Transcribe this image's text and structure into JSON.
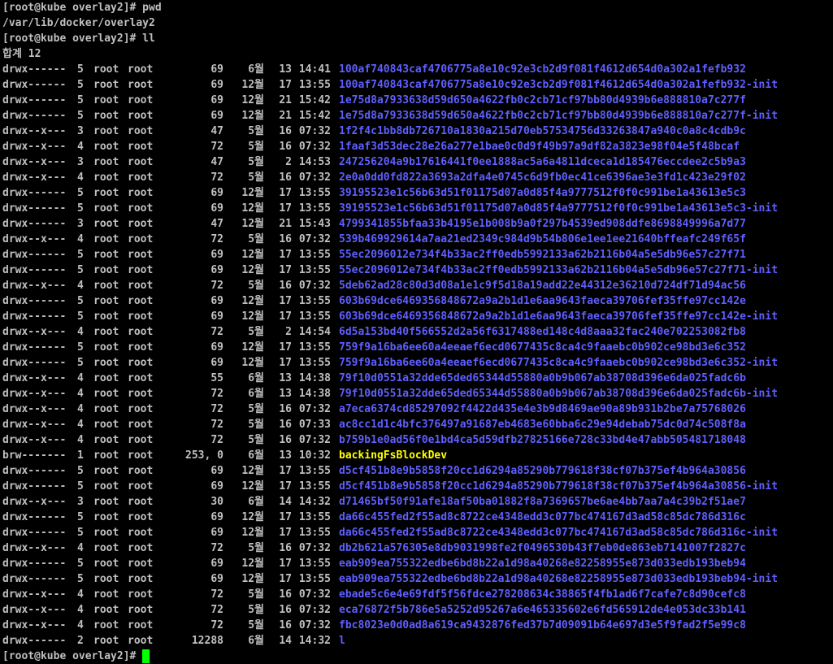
{
  "colors": {
    "background": "#000000",
    "text": "#c0c0c0",
    "directory": "#5f5fff",
    "block_device": "#ffff00",
    "cursor": "#00ff00"
  },
  "terminal": {
    "lines": [
      "[root@kube overlay2]# pwd",
      "/var/lib/docker/overlay2",
      "[root@kube overlay2]# ll",
      "합계 12"
    ],
    "entries": [
      {
        "perms": "drwx------",
        "links": "5",
        "owner": "root",
        "group": "root",
        "size": "69",
        "month": "6월",
        "day": "13",
        "time": "14:41",
        "name": "100af740843caf4706775a8e10c92e3cb2d9f081f4612d654d0a302a1fefb932",
        "kind": "dir"
      },
      {
        "perms": "drwx------",
        "links": "5",
        "owner": "root",
        "group": "root",
        "size": "69",
        "month": "12월",
        "day": "17",
        "time": "13:55",
        "name": "100af740843caf4706775a8e10c92e3cb2d9f081f4612d654d0a302a1fefb932-init",
        "kind": "dir"
      },
      {
        "perms": "drwx------",
        "links": "5",
        "owner": "root",
        "group": "root",
        "size": "69",
        "month": "12월",
        "day": "21",
        "time": "15:42",
        "name": "1e75d8a7933638d59d650a4622fb0c2cb71cf97bb80d4939b6e888810a7c277f",
        "kind": "dir"
      },
      {
        "perms": "drwx------",
        "links": "5",
        "owner": "root",
        "group": "root",
        "size": "69",
        "month": "12월",
        "day": "21",
        "time": "15:42",
        "name": "1e75d8a7933638d59d650a4622fb0c2cb71cf97bb80d4939b6e888810a7c277f-init",
        "kind": "dir"
      },
      {
        "perms": "drwx--x---",
        "links": "3",
        "owner": "root",
        "group": "root",
        "size": "47",
        "month": "5월",
        "day": "16",
        "time": "07:32",
        "name": "1f2f4c1bb8db726710a1830a215d70eb57534756d33263847a940c0a8c4cdb9c",
        "kind": "dir"
      },
      {
        "perms": "drwx--x---",
        "links": "4",
        "owner": "root",
        "group": "root",
        "size": "72",
        "month": "5월",
        "day": "16",
        "time": "07:32",
        "name": "1faaf3d53dec28e26a277e1bae0c0d9f49b97a9df82a3823e98f04e5f48bcaf",
        "kind": "dir"
      },
      {
        "perms": "drwx--x---",
        "links": "3",
        "owner": "root",
        "group": "root",
        "size": "47",
        "month": "5월",
        "day": "2",
        "time": "14:53",
        "name": "247256204a9b17616441f0ee1888ac5a6a4811dceca1d185476eccdee2c5b9a3",
        "kind": "dir"
      },
      {
        "perms": "drwx--x---",
        "links": "4",
        "owner": "root",
        "group": "root",
        "size": "72",
        "month": "5월",
        "day": "16",
        "time": "07:32",
        "name": "2e0a0dd0fd822a3693a2dfa4e0745c6d9fb0ec41ce6396ae3e3fd1c423e29f02",
        "kind": "dir"
      },
      {
        "perms": "drwx------",
        "links": "5",
        "owner": "root",
        "group": "root",
        "size": "69",
        "month": "12월",
        "day": "17",
        "time": "13:55",
        "name": "39195523e1c56b63d51f01175d07a0d85f4a9777512f0f0c991be1a43613e5c3",
        "kind": "dir"
      },
      {
        "perms": "drwx------",
        "links": "5",
        "owner": "root",
        "group": "root",
        "size": "69",
        "month": "12월",
        "day": "17",
        "time": "13:55",
        "name": "39195523e1c56b63d51f01175d07a0d85f4a9777512f0f0c991be1a43613e5c3-init",
        "kind": "dir"
      },
      {
        "perms": "drwx------",
        "links": "3",
        "owner": "root",
        "group": "root",
        "size": "47",
        "month": "12월",
        "day": "21",
        "time": "15:43",
        "name": "4799341855bfaa33b4195e1b008b9a0f297b4539ed908ddfe8698849996a7d77",
        "kind": "dir"
      },
      {
        "perms": "drwx--x---",
        "links": "4",
        "owner": "root",
        "group": "root",
        "size": "72",
        "month": "5월",
        "day": "16",
        "time": "07:32",
        "name": "539b469929614a7aa21ed2349c984d9b54b806e1ee1ee21640bffeafc249f65f",
        "kind": "dir"
      },
      {
        "perms": "drwx------",
        "links": "5",
        "owner": "root",
        "group": "root",
        "size": "69",
        "month": "12월",
        "day": "17",
        "time": "13:55",
        "name": "55ec2096012e734f4b33ac2ff0edb5992133a62b2116b04a5e5db96e57c27f71",
        "kind": "dir"
      },
      {
        "perms": "drwx------",
        "links": "5",
        "owner": "root",
        "group": "root",
        "size": "69",
        "month": "12월",
        "day": "17",
        "time": "13:55",
        "name": "55ec2096012e734f4b33ac2ff0edb5992133a62b2116b04a5e5db96e57c27f71-init",
        "kind": "dir"
      },
      {
        "perms": "drwx--x---",
        "links": "4",
        "owner": "root",
        "group": "root",
        "size": "72",
        "month": "5월",
        "day": "16",
        "time": "07:32",
        "name": "5deb62ad28c80d3d08a1e1c9f5d18a19add22e44312e36210d724df71d94ac56",
        "kind": "dir"
      },
      {
        "perms": "drwx------",
        "links": "5",
        "owner": "root",
        "group": "root",
        "size": "69",
        "month": "12월",
        "day": "17",
        "time": "13:55",
        "name": "603b69dce6469356848672a9a2b1d1e6aa9643faeca39706fef35ffe97cc142e",
        "kind": "dir"
      },
      {
        "perms": "drwx------",
        "links": "5",
        "owner": "root",
        "group": "root",
        "size": "69",
        "month": "12월",
        "day": "17",
        "time": "13:55",
        "name": "603b69dce6469356848672a9a2b1d1e6aa9643faeca39706fef35ffe97cc142e-init",
        "kind": "dir"
      },
      {
        "perms": "drwx--x---",
        "links": "4",
        "owner": "root",
        "group": "root",
        "size": "72",
        "month": "5월",
        "day": "2",
        "time": "14:54",
        "name": "6d5a153bd40f566552d2a56f6317488ed148c4d8aaa32fac240e702253082fb8",
        "kind": "dir"
      },
      {
        "perms": "drwx------",
        "links": "5",
        "owner": "root",
        "group": "root",
        "size": "69",
        "month": "12월",
        "day": "17",
        "time": "13:55",
        "name": "759f9a16ba6ee60a4eeaef6ecd0677435c8ca4c9faaebc0b902ce98bd3e6c352",
        "kind": "dir"
      },
      {
        "perms": "drwx------",
        "links": "5",
        "owner": "root",
        "group": "root",
        "size": "69",
        "month": "12월",
        "day": "17",
        "time": "13:55",
        "name": "759f9a16ba6ee60a4eeaef6ecd0677435c8ca4c9faaebc0b902ce98bd3e6c352-init",
        "kind": "dir"
      },
      {
        "perms": "drwx--x---",
        "links": "4",
        "owner": "root",
        "group": "root",
        "size": "55",
        "month": "6월",
        "day": "13",
        "time": "14:38",
        "name": "79f10d0551a32dde65ded65344d55880a0b9b067ab38708d396e6da025fadc6b",
        "kind": "dir"
      },
      {
        "perms": "drwx--x---",
        "links": "4",
        "owner": "root",
        "group": "root",
        "size": "72",
        "month": "6월",
        "day": "13",
        "time": "14:38",
        "name": "79f10d0551a32dde65ded65344d55880a0b9b067ab38708d396e6da025fadc6b-init",
        "kind": "dir"
      },
      {
        "perms": "drwx--x---",
        "links": "4",
        "owner": "root",
        "group": "root",
        "size": "72",
        "month": "5월",
        "day": "16",
        "time": "07:32",
        "name": "a7eca6374cd85297092f4422d435e4e3b9d8469ae90a89b931b2be7a75768026",
        "kind": "dir"
      },
      {
        "perms": "drwx--x---",
        "links": "4",
        "owner": "root",
        "group": "root",
        "size": "72",
        "month": "5월",
        "day": "16",
        "time": "07:33",
        "name": "ac8cc1d1c4bfc376497a91687eb4683e60bba6c29e94debab75dc0d74c508f8a",
        "kind": "dir"
      },
      {
        "perms": "drwx--x---",
        "links": "4",
        "owner": "root",
        "group": "root",
        "size": "72",
        "month": "5월",
        "day": "16",
        "time": "07:32",
        "name": "b759b1e0ad56f0e1bd4ca5d59dfb27825166e728c33bd4e47abb505481718048",
        "kind": "dir"
      },
      {
        "perms": "brw-------",
        "links": "1",
        "owner": "root",
        "group": "root",
        "size": "253, 0",
        "month": "6월",
        "day": "13",
        "time": "10:32",
        "name": "backingFsBlockDev",
        "kind": "dev"
      },
      {
        "perms": "drwx------",
        "links": "5",
        "owner": "root",
        "group": "root",
        "size": "69",
        "month": "12월",
        "day": "17",
        "time": "13:55",
        "name": "d5cf451b8e9b5858f20cc1d6294a85290b779618f38cf07b375ef4b964a30856",
        "kind": "dir"
      },
      {
        "perms": "drwx------",
        "links": "5",
        "owner": "root",
        "group": "root",
        "size": "69",
        "month": "12월",
        "day": "17",
        "time": "13:55",
        "name": "d5cf451b8e9b5858f20cc1d6294a85290b779618f38cf07b375ef4b964a30856-init",
        "kind": "dir"
      },
      {
        "perms": "drwx--x---",
        "links": "3",
        "owner": "root",
        "group": "root",
        "size": "30",
        "month": "6월",
        "day": "14",
        "time": "14:32",
        "name": "d71465bf50f91afe18af50ba01882f8a7369657be6ae4bb7aa7a4c39b2f51ae7",
        "kind": "dir"
      },
      {
        "perms": "drwx------",
        "links": "5",
        "owner": "root",
        "group": "root",
        "size": "69",
        "month": "12월",
        "day": "17",
        "time": "13:55",
        "name": "da66c455fed2f55ad8c8722ce4348edd3c077bc474167d3ad58c85dc786d316c",
        "kind": "dir"
      },
      {
        "perms": "drwx------",
        "links": "5",
        "owner": "root",
        "group": "root",
        "size": "69",
        "month": "12월",
        "day": "17",
        "time": "13:55",
        "name": "da66c455fed2f55ad8c8722ce4348edd3c077bc474167d3ad58c85dc786d316c-init",
        "kind": "dir"
      },
      {
        "perms": "drwx--x---",
        "links": "4",
        "owner": "root",
        "group": "root",
        "size": "72",
        "month": "5월",
        "day": "16",
        "time": "07:32",
        "name": "db2b621a576305e8db9031998fe2f0496530b43f7eb0de863eb7141007f2827c",
        "kind": "dir"
      },
      {
        "perms": "drwx------",
        "links": "5",
        "owner": "root",
        "group": "root",
        "size": "69",
        "month": "12월",
        "day": "17",
        "time": "13:55",
        "name": "eab909ea755322edbe6bd8b22a1d98a40268e82258955e873d033edb193beb94",
        "kind": "dir"
      },
      {
        "perms": "drwx------",
        "links": "5",
        "owner": "root",
        "group": "root",
        "size": "69",
        "month": "12월",
        "day": "17",
        "time": "13:55",
        "name": "eab909ea755322edbe6bd8b22a1d98a40268e82258955e873d033edb193beb94-init",
        "kind": "dir"
      },
      {
        "perms": "drwx--x---",
        "links": "4",
        "owner": "root",
        "group": "root",
        "size": "72",
        "month": "5월",
        "day": "16",
        "time": "07:32",
        "name": "ebade5c6e4e69fdf5f56fdce278208634c38865f4fb1ad6f7cafe7c8d90cefc8",
        "kind": "dir"
      },
      {
        "perms": "drwx--x---",
        "links": "4",
        "owner": "root",
        "group": "root",
        "size": "72",
        "month": "5월",
        "day": "16",
        "time": "07:32",
        "name": "eca76872f5b786e5a5252d95267a6e465335602e6fd565912de4e053dc33b141",
        "kind": "dir"
      },
      {
        "perms": "drwx--x---",
        "links": "4",
        "owner": "root",
        "group": "root",
        "size": "72",
        "month": "5월",
        "day": "16",
        "time": "07:32",
        "name": "fbc8023e0d0ad8a619ca9432876fed37b7d09091b64e697d3e5f9fad2f5e99c8",
        "kind": "dir"
      },
      {
        "perms": "drwx------",
        "links": "2",
        "owner": "root",
        "group": "root",
        "size": "12288",
        "month": "6월",
        "day": "14",
        "time": "14:32",
        "name": "l",
        "kind": "dir"
      }
    ],
    "final_prompt": "[root@kube overlay2]# "
  }
}
